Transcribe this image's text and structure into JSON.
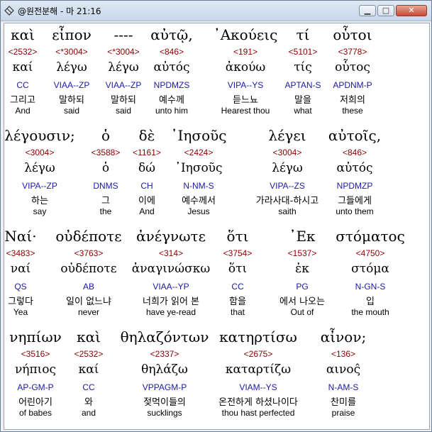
{
  "window": {
    "title": "@원전분해 - 마 21:16",
    "icon": "diamond-app-icon"
  },
  "controls": {
    "minimize": "▁",
    "maximize": "□",
    "close": "✕"
  },
  "rows": [
    [
      {
        "greek": "καὶ",
        "strong": "<2532>",
        "lemma": "καί",
        "parse": "CC",
        "korean": "그리고",
        "english": "And"
      },
      {
        "greek": "εἶπον",
        "strong": "<*3004>",
        "lemma": "λέγω",
        "parse": "VIAA--ZP",
        "korean": "말하되",
        "english": "said"
      },
      {
        "greek": "----",
        "strong": "<*3004>",
        "lemma": "λέγω",
        "parse": "VIAA--ZP",
        "korean": "말하되",
        "english": "said"
      },
      {
        "greek": "αὐτῷ,",
        "strong": "<846>",
        "lemma": "αὐτός",
        "parse": "NPDMZS",
        "korean": "예수께",
        "english": "unto him"
      },
      {
        "greek": "᾿Ακούεις",
        "strong": "<191>",
        "lemma": "ἀκούω",
        "parse": "VIPA--YS",
        "korean": "듣느뇨",
        "english": "Hearest thou"
      },
      {
        "greek": "τί",
        "strong": "<5101>",
        "lemma": "τίς",
        "parse": "APTAN-S",
        "korean": "말을",
        "english": "what"
      },
      {
        "greek": "οὗτοι",
        "strong": "<3778>",
        "lemma": "οὗτος",
        "parse": "APDNM-P",
        "korean": "저희의",
        "english": "these"
      }
    ],
    [
      {
        "greek": "λέγουσιν;",
        "strong": "<3004>",
        "lemma": "λέγω",
        "parse": "VIPA--ZP",
        "korean": "하는",
        "english": "say"
      },
      {
        "greek": "ὁ",
        "strong": "<3588>",
        "lemma": "ὁ",
        "parse": "DNMS",
        "korean": "그",
        "english": "the"
      },
      {
        "greek": "δὲ",
        "strong": "<1161>",
        "lemma": "δώ",
        "parse": "CH",
        "korean": "이에",
        "english": "And"
      },
      {
        "greek": "᾿Ιησοῦς",
        "strong": "<2424>",
        "lemma": "᾿Ιησοῦς",
        "parse": "N-NM-S",
        "korean": "예수께서",
        "english": "Jesus"
      },
      {
        "greek": "λέγει",
        "strong": "<3004>",
        "lemma": "λέγω",
        "parse": "VIPA--ZS",
        "korean": "가라사대-하시고",
        "english": "saith"
      },
      {
        "greek": "αὐτοῖς,",
        "strong": "<846>",
        "lemma": "αὐτός",
        "parse": "NPDMZP",
        "korean": "그들에게",
        "english": "unto them"
      }
    ],
    [
      {
        "greek": "Ναί·",
        "strong": "<3483>",
        "lemma": "ναί",
        "parse": "QS",
        "korean": "그렇다",
        "english": "Yea"
      },
      {
        "greek": "οὐδέποτε",
        "strong": "<3763>",
        "lemma": "οὐδέποτε",
        "parse": "AB",
        "korean": "일이 없느냐",
        "english": "never"
      },
      {
        "greek": "ἀνέγνωτε",
        "strong": "<314>",
        "lemma": "ἀναγινώσκω",
        "parse": "VIAA--YP",
        "korean": "너희가 읽어 본",
        "english": "have ye-read"
      },
      {
        "greek": "ὅτι",
        "strong": "<3754>",
        "lemma": "ὅτι",
        "parse": "CC",
        "korean": "함을",
        "english": "that"
      },
      {
        "greek": "᾿Εκ",
        "strong": "<1537>",
        "lemma": "ἐκ",
        "parse": "PG",
        "korean": "에서 나오는",
        "english": "Out of"
      },
      {
        "greek": "στόματος",
        "strong": "<4750>",
        "lemma": "στόμα",
        "parse": "N-GN-S",
        "korean": "입",
        "english": "the mouth"
      }
    ],
    [
      {
        "greek": "νηπίων",
        "strong": "<3516>",
        "lemma": "νήπιος",
        "parse": "AP-GM-P",
        "korean": "어린아기",
        "english": "of babes"
      },
      {
        "greek": "καὶ",
        "strong": "<2532>",
        "lemma": "καί",
        "parse": "CC",
        "korean": "와",
        "english": "and"
      },
      {
        "greek": "θηλαζόντων",
        "strong": "<2337>",
        "lemma": "θηλάζω",
        "parse": "VPPAGM-P",
        "korean": "젖먹이들의",
        "english": "sucklings"
      },
      {
        "greek": "κατηρτίσω",
        "strong": "<2675>",
        "lemma": "καταρτίζω",
        "parse": "VIAM--YS",
        "korean": "온전하게 하셨나이다",
        "english": "thou hast perfected"
      },
      {
        "greek": "αἶνον;",
        "strong": "<136>",
        "lemma": "αινος̂",
        "parse": "N-AM-S",
        "korean": "찬미를",
        "english": "praise"
      }
    ]
  ]
}
